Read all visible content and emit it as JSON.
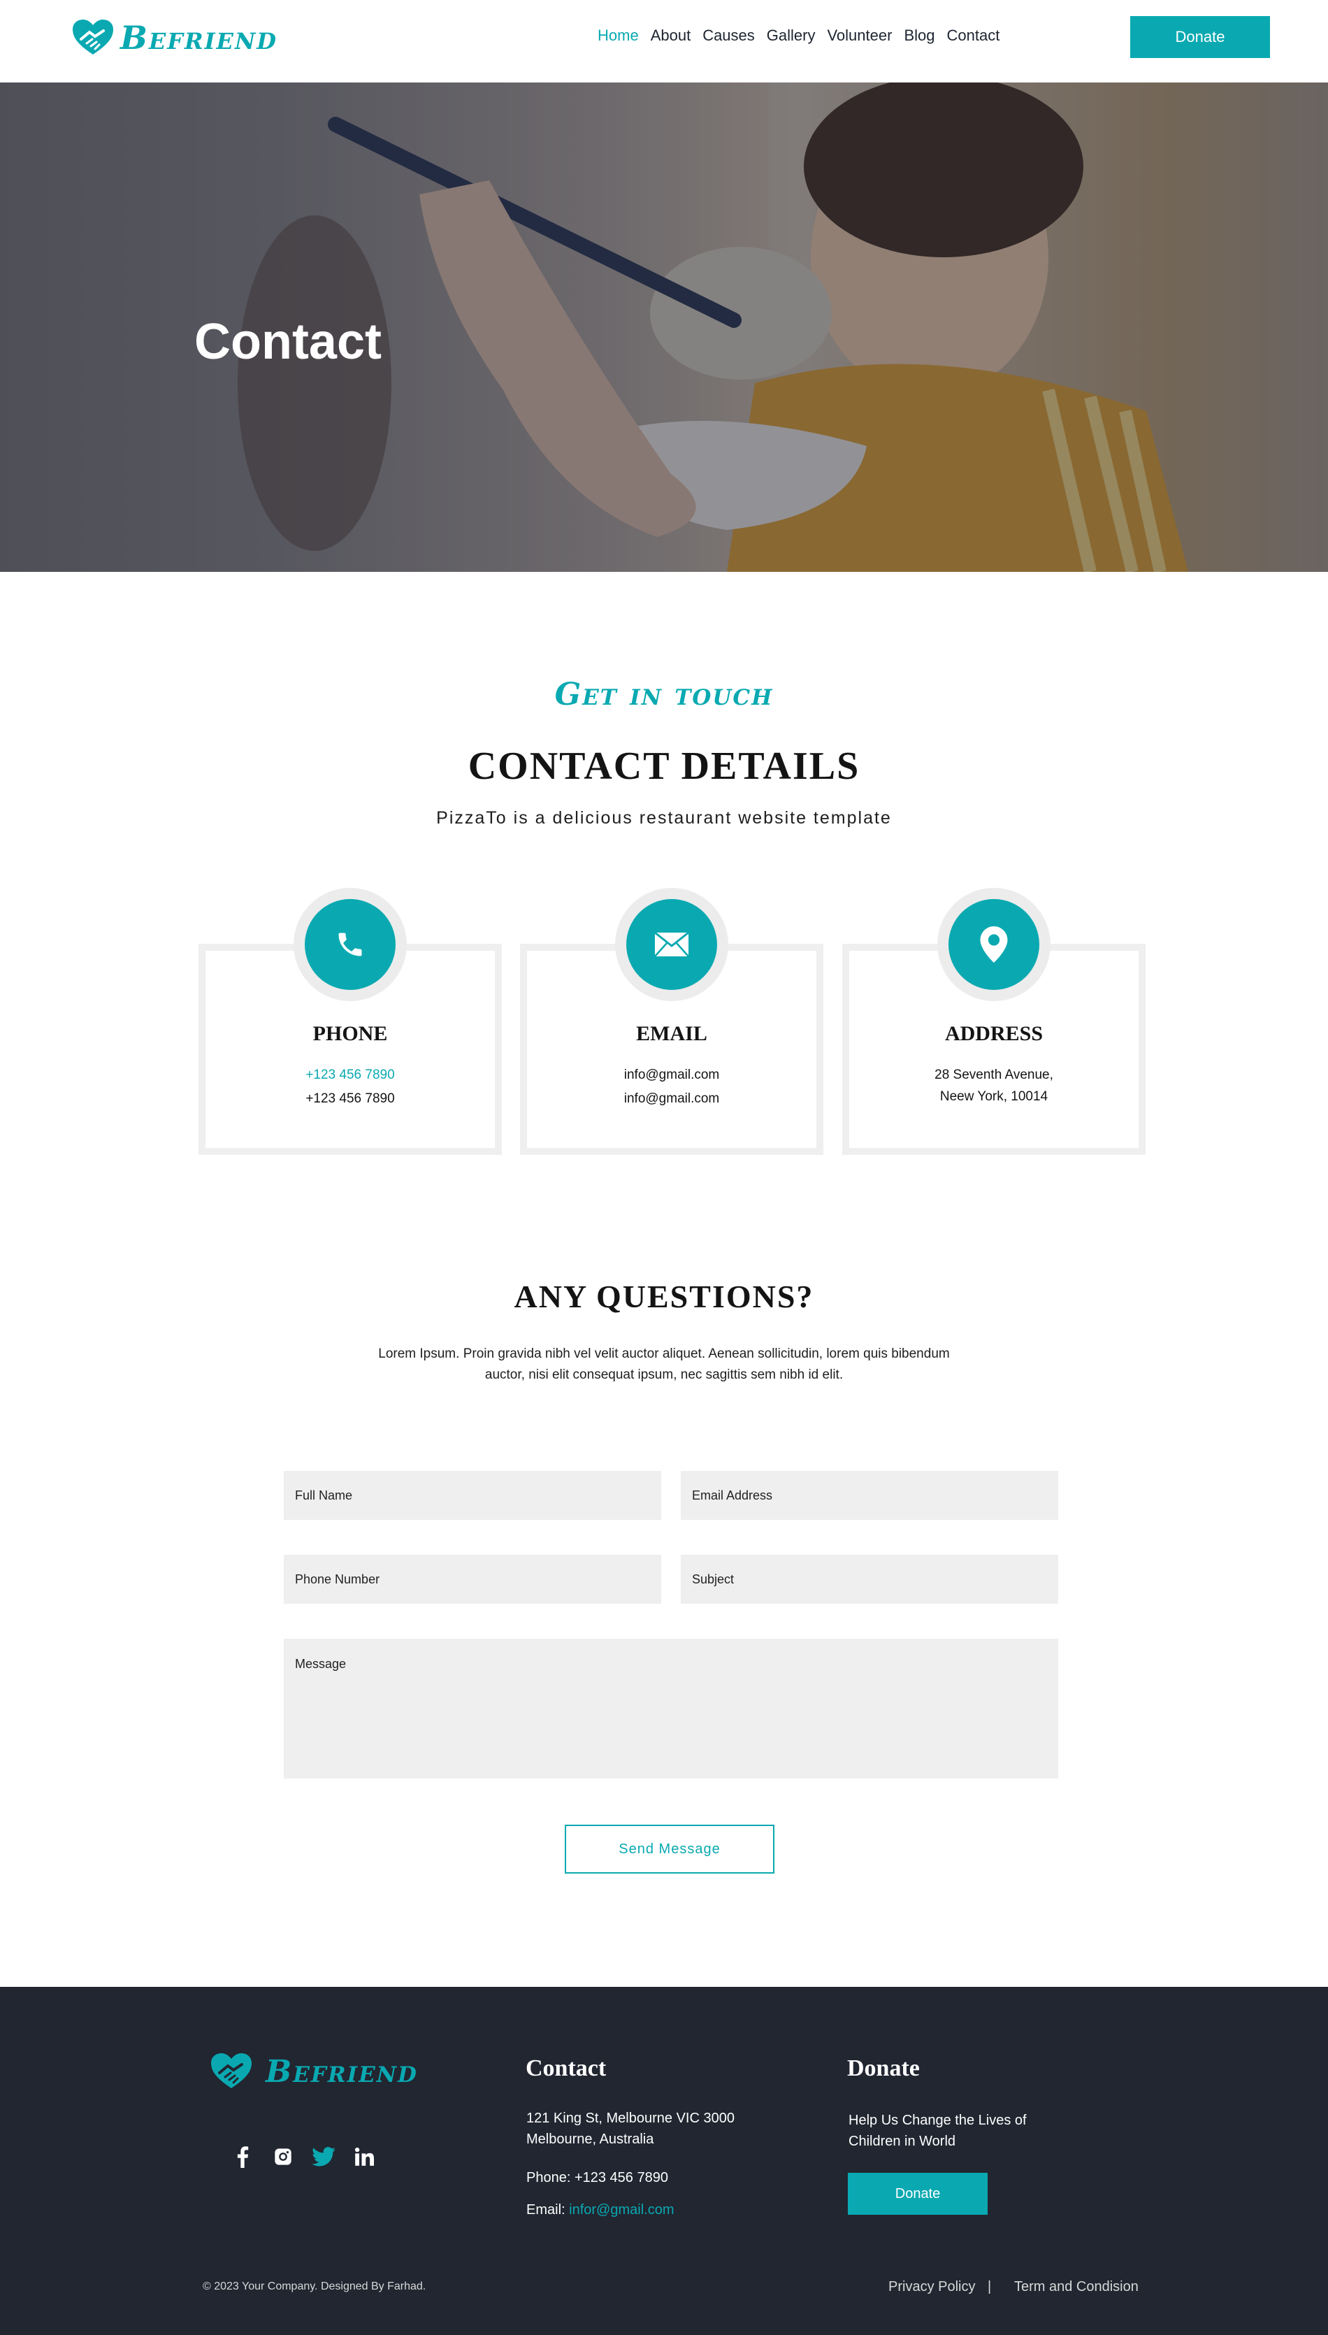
{
  "brand": {
    "name": "Befriend",
    "color": "#0aa9b1"
  },
  "nav": {
    "items": [
      {
        "label": "Home",
        "active": true
      },
      {
        "label": "About"
      },
      {
        "label": "Causes"
      },
      {
        "label": "Gallery"
      },
      {
        "label": "Volunteer"
      },
      {
        "label": "Blog"
      },
      {
        "label": "Contact"
      }
    ],
    "donate_label": "Donate"
  },
  "hero": {
    "title": "Contact"
  },
  "contact_section": {
    "eyebrow": "Get in touch",
    "title": "CONTACT DETAILS",
    "subtitle": "PizzaTo is a delicious restaurant website template"
  },
  "cards": [
    {
      "icon": "phone-icon",
      "title": "PHONE",
      "lines": [
        "+123 456 7890",
        "+123 456 7890"
      ]
    },
    {
      "icon": "envelope-icon",
      "title": "EMAIL",
      "lines": [
        "info@gmail.com",
        "info@gmail.com"
      ]
    },
    {
      "icon": "map-pin-icon",
      "title": "ADDRESS",
      "lines": [
        "28 Seventh Avenue,",
        "Neew York, 10014"
      ]
    }
  ],
  "questions": {
    "title": "ANY QUESTIONS?",
    "text": "Lorem Ipsum. Proin gravida nibh vel velit auctor aliquet. Aenean sollicitudin, lorem quis bibendum auctor, nisi elit consequat ipsum, nec sagittis sem nibh id elit."
  },
  "form": {
    "full_name_placeholder": "Full Name",
    "email_placeholder": "Email Address",
    "phone_placeholder": "Phone Number",
    "subject_placeholder": "Subject",
    "message_placeholder": "Message",
    "send_label": "Send Message"
  },
  "footer": {
    "socials": [
      "facebook-icon",
      "instagram-icon",
      "twitter-icon",
      "linkedin-icon"
    ],
    "contact_heading": "Contact",
    "address_line1": "121 King St, Melbourne VIC 3000",
    "address_line2": "Melbourne, Australia",
    "phone": "Phone: +123 456 7890",
    "email_label": "Email:",
    "email_value": "infor@gmail.com",
    "donate_heading": "Donate",
    "donate_text_line1": "Help Us Change the Lives of",
    "donate_text_line2": "Children in World",
    "donate_button": "Donate",
    "copyright": "© 2023 Your Company. Designed By Farhad.",
    "privacy": "Privacy Policy",
    "separator": "|",
    "terms": "Term and Condision"
  }
}
